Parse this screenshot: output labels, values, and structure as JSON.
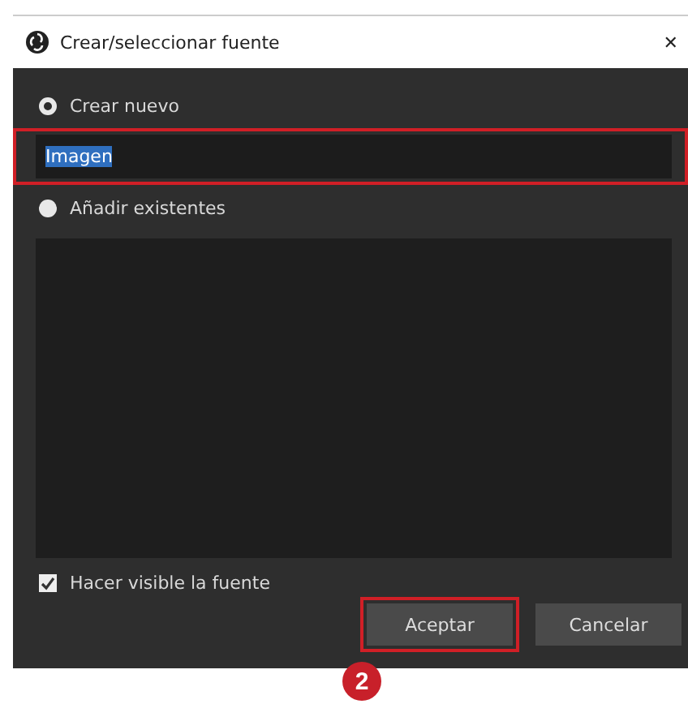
{
  "window": {
    "title": "Crear/seleccionar fuente",
    "close_glyph": "✕"
  },
  "options": [
    {
      "label": "Crear nuevo",
      "selected": true
    },
    {
      "label": "Añadir existentes",
      "selected": false
    }
  ],
  "name_field": {
    "value": "Imagen",
    "highlighted": true
  },
  "visible_checkbox": {
    "label": "Hacer visible la fuente",
    "checked": true
  },
  "buttons": [
    {
      "label": "Aceptar",
      "highlighted": true
    },
    {
      "label": "Cancelar",
      "highlighted": false
    }
  ],
  "annotation_badge": "2"
}
